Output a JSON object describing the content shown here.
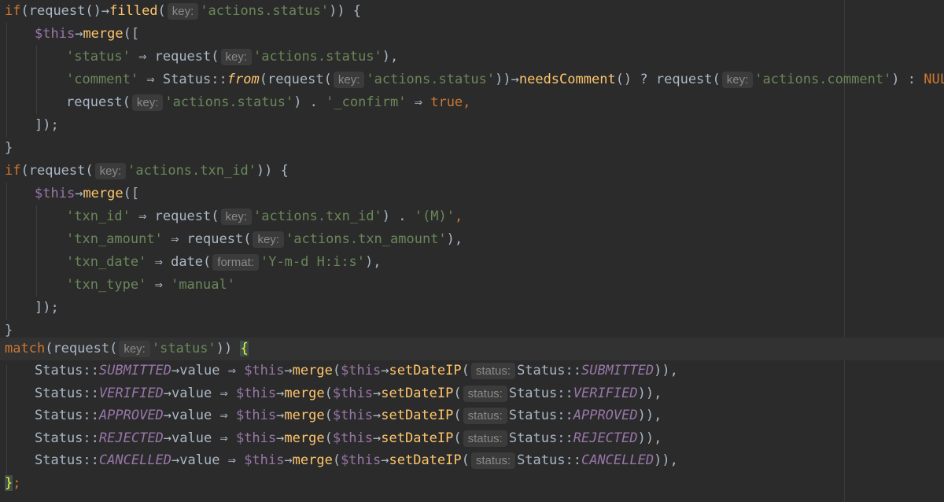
{
  "code": {
    "l1": {
      "if": "if",
      "paren": "(",
      "req": "request",
      "call": "()",
      "arrow": "→",
      "filled": "filled",
      "open": "(",
      "hint": "key:",
      "arg": "'actions.status'",
      "close": ")) {"
    },
    "l2": {
      "this": "$this",
      "arrow": "→",
      "merge": "merge",
      "open": "(["
    },
    "l3": {
      "k": "'status'",
      "op": " ⇒ ",
      "req": "request",
      "open": "(",
      "hint": "key:",
      "arg": "'actions.status'",
      "close": "),"
    },
    "l4": {
      "k": "'comment'",
      "op": " ⇒ ",
      "cls": "Status",
      "sep": "::",
      "from": "from",
      "open": "(",
      "req": "request",
      "open2": "(",
      "hint": "key:",
      "arg": "'actions.status'",
      "mid": "))→",
      "needs": "needsComment",
      "q": "() ? ",
      "req2": "request",
      "open3": "(",
      "hint2": "key:",
      "arg2": "'actions.comment'",
      "end": ") : ",
      "null": "NULL",
      "comma": ","
    },
    "l5": {
      "req": "request",
      "open": "(",
      "hint": "key:",
      "arg": "'actions.status'",
      "dot": ") . ",
      "conf": "'_confirm'",
      "op": " ⇒ ",
      "tr": "true",
      "comma": ","
    },
    "l6": {
      "t": "]);"
    },
    "l7": {
      "t": "}"
    },
    "l8": {
      "if": "if",
      "open": "(",
      "req": "request",
      "open2": "(",
      "hint": "key:",
      "arg": "'actions.txn_id'",
      "close": ")) {"
    },
    "l9": {
      "this": "$this",
      "arrow": "→",
      "merge": "merge",
      "open": "(["
    },
    "l10": {
      "k": "'txn_id'",
      "op": " ⇒ ",
      "req": "request",
      "open": "(",
      "hint": "key:",
      "arg": "'actions.txn_id'",
      "dot": ") . ",
      "m": "'(M)'",
      "comma": ","
    },
    "l11": {
      "k": "'txn_amount'",
      "op": " ⇒ ",
      "req": "request",
      "open": "(",
      "hint": "key:",
      "arg": "'actions.txn_amount'",
      "close": "),"
    },
    "l12": {
      "k": "'txn_date'",
      "op": " ⇒ ",
      "date": "date",
      "open": "(",
      "hint": "format:",
      "arg": "'Y-m-d H:i:s'",
      "close": "),"
    },
    "l13": {
      "k": "'txn_type'",
      "op": " ⇒ ",
      "v": "'manual'"
    },
    "l14": {
      "t": "]);"
    },
    "l15": {
      "t": "}"
    },
    "l16": {
      "match": "match",
      "open": "(",
      "req": "request",
      "open2": "(",
      "hint": "key:",
      "arg": "'status'",
      "close": ")) ",
      "brace": "{"
    },
    "cases": [
      {
        "cls": "Status",
        "sep": "::",
        "en": "SUBMITTED",
        "arrow": "→",
        "val": "value",
        "op": " ⇒ ",
        "this": "$this",
        "a2": "→",
        "merge": "merge",
        "open": "(",
        "this2": "$this",
        "a3": "→",
        "set": "setDateIP",
        "open2": "(",
        "hint": "status:",
        "cls2": "Status",
        "sep2": "::",
        "en2": "SUBMITTED",
        "close": ")),"
      },
      {
        "cls": "Status",
        "sep": "::",
        "en": "VERIFIED",
        "arrow": "→",
        "val": "value",
        "op": " ⇒ ",
        "this": "$this",
        "a2": "→",
        "merge": "merge",
        "open": "(",
        "this2": "$this",
        "a3": "→",
        "set": "setDateIP",
        "open2": "(",
        "hint": "status:",
        "cls2": "Status",
        "sep2": "::",
        "en2": "VERIFIED",
        "close": ")),"
      },
      {
        "cls": "Status",
        "sep": "::",
        "en": "APPROVED",
        "arrow": "→",
        "val": "value",
        "op": " ⇒ ",
        "this": "$this",
        "a2": "→",
        "merge": "merge",
        "open": "(",
        "this2": "$this",
        "a3": "→",
        "set": "setDateIP",
        "open2": "(",
        "hint": "status:",
        "cls2": "Status",
        "sep2": "::",
        "en2": "APPROVED",
        "close": ")),"
      },
      {
        "cls": "Status",
        "sep": "::",
        "en": "REJECTED",
        "arrow": "→",
        "val": "value",
        "op": " ⇒ ",
        "this": "$this",
        "a2": "→",
        "merge": "merge",
        "open": "(",
        "this2": "$this",
        "a3": "→",
        "set": "setDateIP",
        "open2": "(",
        "hint": "status:",
        "cls2": "Status",
        "sep2": "::",
        "en2": "REJECTED",
        "close": ")),"
      },
      {
        "cls": "Status",
        "sep": "::",
        "en": "CANCELLED",
        "arrow": "→",
        "val": "value",
        "op": " ⇒ ",
        "this": "$this",
        "a2": "→",
        "merge": "merge",
        "open": "(",
        "this2": "$this",
        "a3": "→",
        "set": "setDateIP",
        "open2": "(",
        "hint": "status:",
        "cls2": "Status",
        "sep2": "::",
        "en2": "CANCELLED",
        "close": ")),"
      }
    ],
    "l22": {
      "brace": "}",
      "semi": ";"
    }
  }
}
